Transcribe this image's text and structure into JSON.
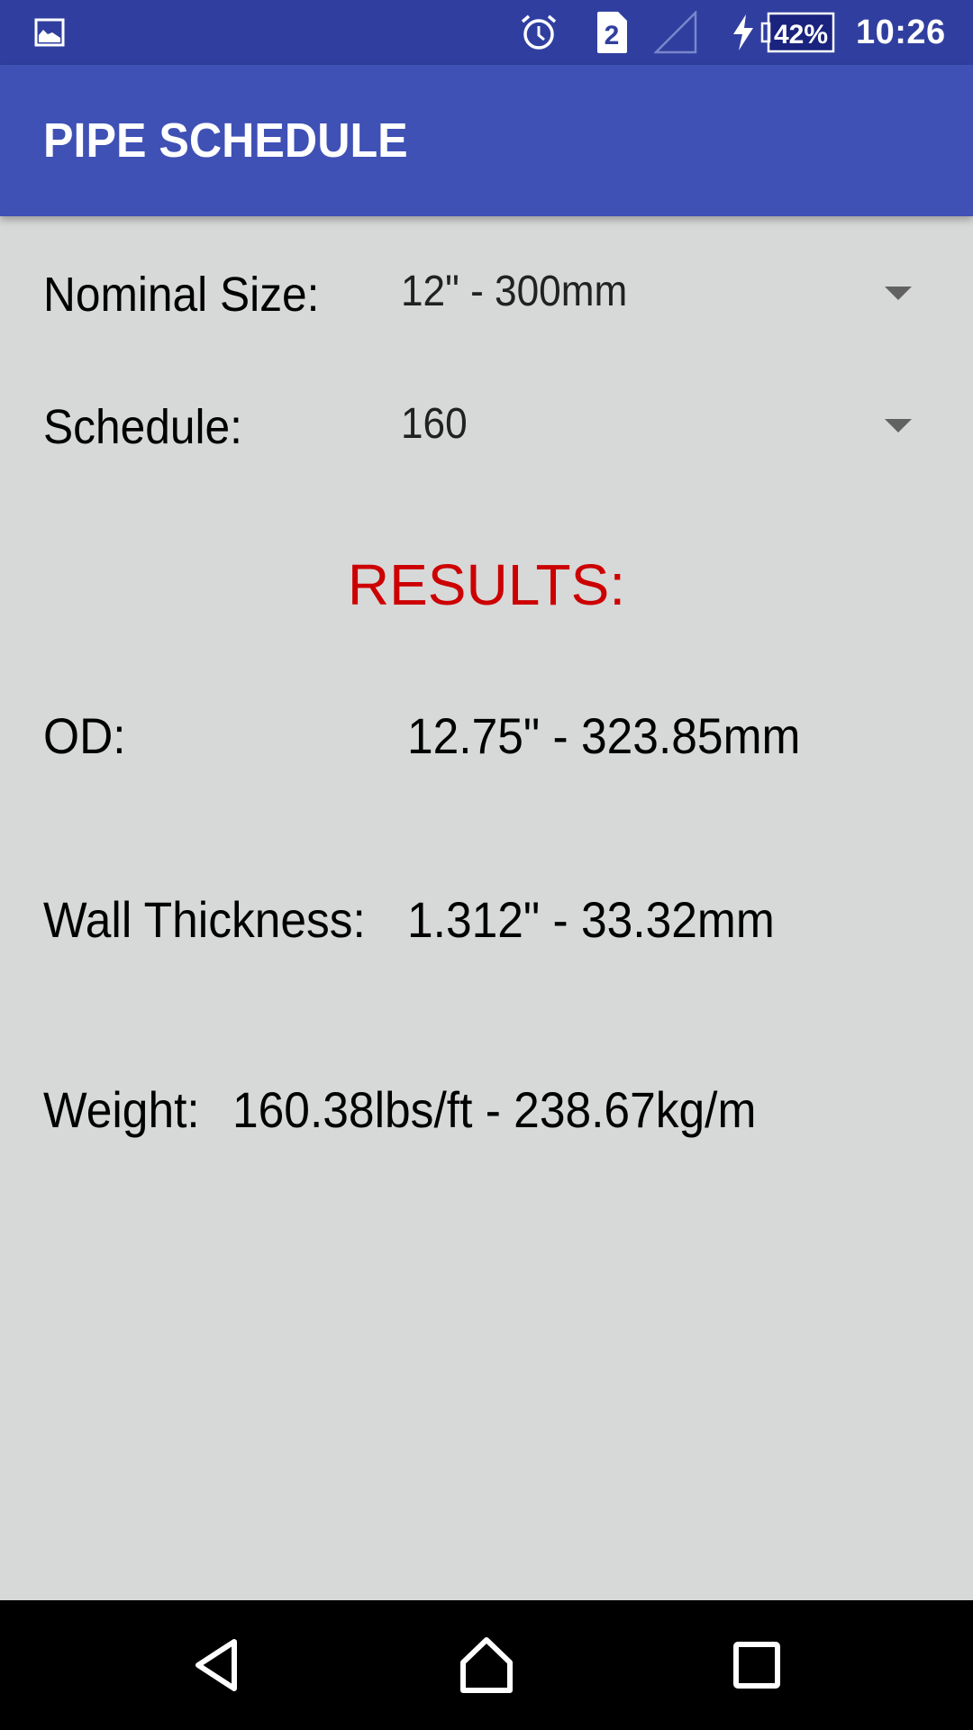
{
  "status_bar": {
    "notification_icon": "image-icon",
    "alarm_icon": "alarm-clock-icon",
    "sim_badge": "2",
    "signal_icon": "cellular-signal-empty-icon",
    "charging_icon": "lightning-bolt-icon",
    "battery_percent": "42%",
    "battery_level": 0.42,
    "time": "10:26"
  },
  "app_bar": {
    "title": "PIPE SCHEDULE",
    "color": "#3F51B5",
    "status_color": "#303F9F"
  },
  "form": {
    "nominal_size": {
      "label": "Nominal Size:",
      "selected_value": "12\" - 300mm"
    },
    "schedule": {
      "label": "Schedule:",
      "selected_value": "160"
    }
  },
  "results": {
    "title": "RESULTS:",
    "title_color": "#CC0000",
    "od": {
      "label": "OD:",
      "value": "12.75\" - 323.85mm"
    },
    "wall_thickness": {
      "label": "Wall Thickness:",
      "value": "1.312\" - 33.32mm"
    },
    "weight": {
      "label": "Weight:",
      "value": "160.38lbs/ft - 238.67kg/m"
    }
  },
  "nav_bar": {
    "back": "back-icon",
    "home": "home-icon",
    "recents": "recents-icon"
  }
}
